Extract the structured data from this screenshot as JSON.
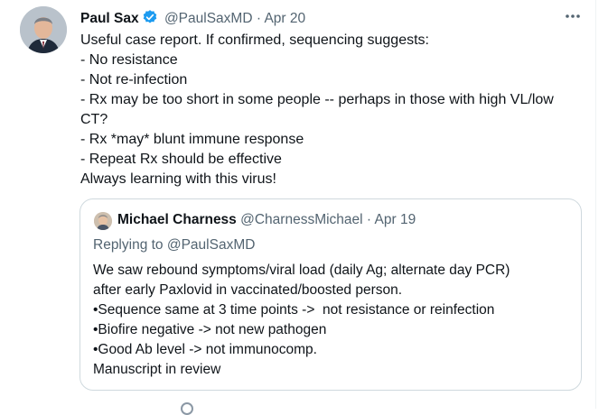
{
  "tweet": {
    "author_name": "Paul Sax",
    "handle": "@PaulSaxMD",
    "separator": "·",
    "date": "Apr 20",
    "verified": true,
    "lines": [
      "Useful case report. If confirmed, sequencing suggests:",
      "- No resistance",
      "- Not re-infection",
      "- Rx may be too short in some people -- perhaps in those with high VL/low",
      "CT?",
      "- Rx *may* blunt immune response",
      "- Repeat Rx should be effective",
      "Always learning with this virus!"
    ]
  },
  "quote": {
    "author_name": "Michael Charness",
    "handle": "@CharnessMichael",
    "separator": "·",
    "date": "Apr 19",
    "replying_prefix": "Replying to",
    "replying_handle": "@PaulSaxMD",
    "lines": [
      "We saw rebound symptoms/viral load (daily Ag; alternate day PCR)",
      "after early Paxlovid in vaccinated/boosted person.",
      "•Sequence same at 3 time points ->  not resistance or reinfection",
      "•Biofire negative -> not new pathogen",
      "•Good Ab level -> not immunocomp.",
      "Manuscript in review"
    ]
  },
  "icons": {
    "verified": "verified-badge-icon",
    "more": "more-options-icon"
  },
  "colors": {
    "text": "#0f1419",
    "muted": "#536471",
    "verified": "#1d9bf0",
    "border": "#cfd9de"
  }
}
